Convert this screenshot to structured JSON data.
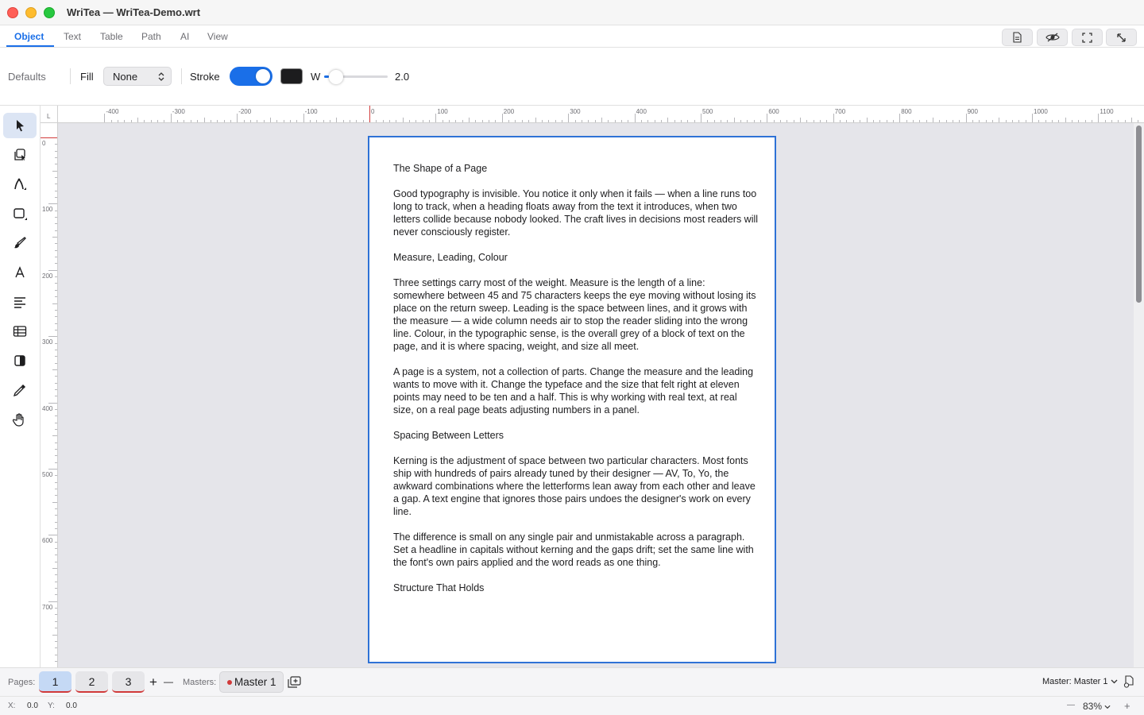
{
  "window": {
    "title": "WriTea — WriTea-Demo.wrt"
  },
  "tabs": [
    {
      "label": "Object",
      "active": true
    },
    {
      "label": "Text",
      "active": false
    },
    {
      "label": "Table",
      "active": false
    },
    {
      "label": "Path",
      "active": false
    },
    {
      "label": "AI",
      "active": false
    },
    {
      "label": "View",
      "active": false
    }
  ],
  "view_buttons": [
    "document-icon",
    "eye-slash-icon",
    "fullscreen-icon",
    "expand-arrows-icon"
  ],
  "props": {
    "defaults_label": "Defaults",
    "fill_label": "Fill",
    "fill_value": "None",
    "stroke_label": "Stroke",
    "stroke_enabled": true,
    "stroke_color": "#1c1c1e",
    "width_label": "W",
    "width_value": "2.0",
    "width_slider_fraction": 0.08
  },
  "tools": [
    {
      "name": "select-tool",
      "icon": "arrow-cursor-icon",
      "active": true
    },
    {
      "name": "direct-select-tool",
      "icon": "copy-select-icon",
      "active": false
    },
    {
      "name": "pen-tool",
      "icon": "pen-nib-icon",
      "active": false
    },
    {
      "name": "shape-tool",
      "icon": "square-icon",
      "active": false
    },
    {
      "name": "brush-tool",
      "icon": "brush-icon",
      "active": false
    },
    {
      "name": "text-tool",
      "icon": "letter-a-icon",
      "active": false
    },
    {
      "name": "text-flow-tool",
      "icon": "align-left-icon",
      "active": false
    },
    {
      "name": "table-tool",
      "icon": "table-icon",
      "active": false
    },
    {
      "name": "gradient-tool",
      "icon": "half-square-icon",
      "active": false
    },
    {
      "name": "eyedropper-tool",
      "icon": "eyedropper-icon",
      "active": false
    },
    {
      "name": "hand-tool",
      "icon": "hand-icon",
      "active": false
    }
  ],
  "rulers": {
    "corner_label": "L",
    "horizontal": [
      "-400",
      "-300",
      "-200",
      "-100",
      "0",
      "100",
      "200",
      "300",
      "400",
      "500",
      "600",
      "700",
      "800",
      "900",
      "1000",
      "1100"
    ],
    "vertical": [
      "0",
      "100",
      "200",
      "300",
      "400",
      "500",
      "600",
      "700"
    ]
  },
  "document": {
    "paragraphs": [
      "The Shape of a Page",
      "Good typography is invisible. You notice it only when it fails — when a line runs too long to track, when a heading floats away from the text it introduces, when two letters collide because nobody looked. The craft lives in decisions most readers will never consciously register.",
      "Measure, Leading, Colour",
      "Three settings carry most of the weight. Measure is the length of a line: somewhere between 45 and 75 characters keeps the eye moving without losing its place on the return sweep. Leading is the space between lines, and it grows with the measure — a wide column needs air to stop the reader sliding into the wrong line. Colour, in the typographic sense, is the overall grey of a block of text on the page, and it is where spacing, weight, and size all meet.",
      "A page is a system, not a collection of parts. Change the measure and the leading wants to move with it. Change the typeface and the size that felt right at eleven points may need to be ten and a half. This is why working with real text, at real size, on a real page beats adjusting numbers in a panel.",
      "Spacing Between Letters",
      "Kerning is the adjustment of space between two particular characters. Most fonts ship with hundreds of pairs already tuned by their designer — AV, To, Yo, the awkward combinations where the letterforms lean away from each other and leave a gap. A text engine that ignores those pairs undoes the designer's work on every line.",
      "The difference is small on any single pair and unmistakable across a paragraph. Set a headline in capitals without kerning and the gaps drift; set the same line with the font's own pairs applied and the word reads as one thing.",
      "Structure That Holds"
    ]
  },
  "pages_bar": {
    "pages_label": "Pages:",
    "pages": [
      "1",
      "2",
      "3"
    ],
    "current_page": "1",
    "add_symbol": "+",
    "remove_symbol": "—",
    "masters_label": "Masters:",
    "master_button": "Master 1",
    "master_select": "Master: Master 1"
  },
  "status": {
    "x_label": "X:",
    "x_value": "0.0",
    "y_label": "Y:",
    "y_value": "0.0",
    "zoom_out": "—",
    "zoom": "83%",
    "zoom_in": "+"
  },
  "colors": {
    "accent": "#1a6fe8",
    "page_marker": "#d13a3a"
  }
}
